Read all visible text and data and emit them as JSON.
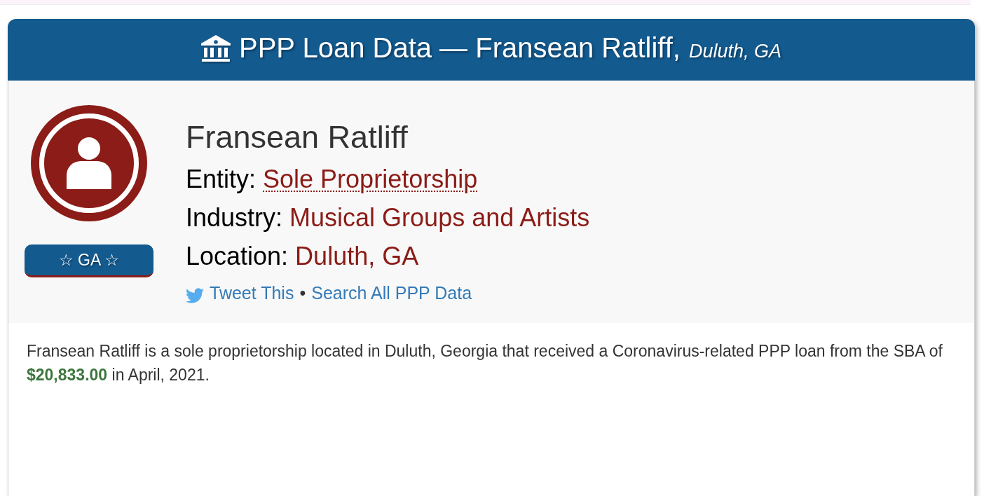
{
  "header": {
    "title": "PPP Loan Data — Fransean Ratliff,",
    "subtitle": "Duluth, GA"
  },
  "profile": {
    "badge": "☆ GA ☆",
    "name": "Fransean Ratliff",
    "fields": [
      {
        "label": "Entity:",
        "value": "Sole Proprietorship",
        "kind": "abbr"
      },
      {
        "label": "Industry:",
        "value": "Musical Groups and Artists",
        "kind": "link"
      },
      {
        "label": "Location:",
        "value": "Duluth, GA",
        "kind": "link"
      }
    ],
    "links": [
      {
        "label": "Tweet This",
        "kind": "tweet"
      },
      {
        "label": "Search All PPP Data",
        "kind": "plain"
      }
    ],
    "separator": "•"
  },
  "summary": "Fransean Ratliff is a sole proprietorship located in Duluth, Georgia that received a Coronavirus-related PPP loan from the SBA of **$20,833.00** in April, 2021."
}
